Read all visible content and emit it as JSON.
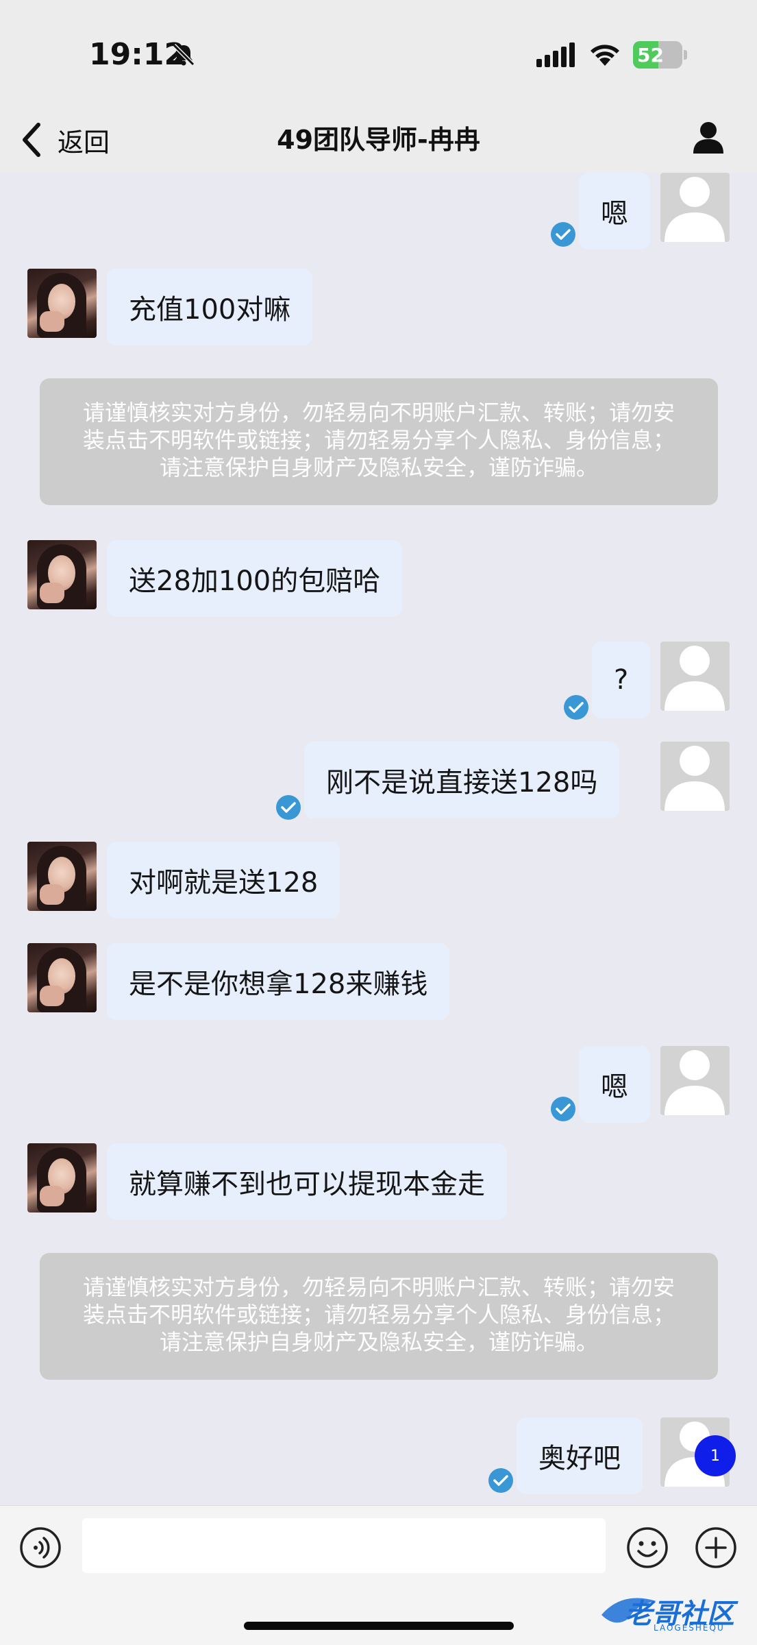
{
  "status_bar": {
    "time": "19:12",
    "battery_level": 52,
    "battery_text": "52"
  },
  "nav": {
    "back_label": "返回",
    "title": "49团队导师-冉冉"
  },
  "colors": {
    "bubble": "#e8effc",
    "check_blue": "#3a97d6",
    "warning_bg": "#cccccc",
    "badge": "#0f1ee8"
  },
  "messages": [
    {
      "side": "right",
      "text": "嗯",
      "read": true
    },
    {
      "side": "left",
      "text": "充值100对嘛"
    },
    {
      "type": "warning",
      "text": "请谨慎核实对方身份，勿轻易向不明账户汇款、转账；请勿安装点击不明软件或链接；请勿轻易分享个人隐私、身份信息；请注意保护自身财产及隐私安全，谨防诈骗。"
    },
    {
      "side": "left",
      "text": "送28加100的包赔哈"
    },
    {
      "side": "right",
      "text": "?",
      "read": true
    },
    {
      "side": "right",
      "text": "刚不是说直接送128吗",
      "read": true
    },
    {
      "side": "left",
      "text": "对啊就是送128"
    },
    {
      "side": "left",
      "text": "是不是你想拿128来赚钱"
    },
    {
      "side": "right",
      "text": "嗯",
      "read": true
    },
    {
      "side": "left",
      "text": "就算赚不到也可以提现本金走"
    },
    {
      "type": "warning",
      "text": "请谨慎核实对方身份，勿轻易向不明账户汇款、转账；请勿安装点击不明软件或链接；请勿轻易分享个人隐私、身份信息；请注意保护自身财产及隐私安全，谨防诈骗。"
    },
    {
      "side": "right",
      "text": "奥好吧",
      "read": true
    }
  ],
  "warning_lines": [
    "请谨慎核实对方身份，勿轻易向不明账户汇款、转账；请勿安",
    "装点击不明软件或链接；请勿轻易分享个人隐私、身份信息；",
    "请注意保护自身财产及隐私安全，谨防诈骗。"
  ],
  "unread_badge": "1",
  "input": {
    "value": "",
    "placeholder": ""
  },
  "icons": {
    "back": "chevron-left-icon",
    "profile": "person-icon",
    "voice": "voice-icon",
    "emoji": "smiley-icon",
    "plus": "plus-icon",
    "read": "check-circle-icon",
    "mute": "bell-slash-icon"
  },
  "watermark": {
    "text": "老哥社区",
    "sub": "LAOGESHEQU"
  }
}
